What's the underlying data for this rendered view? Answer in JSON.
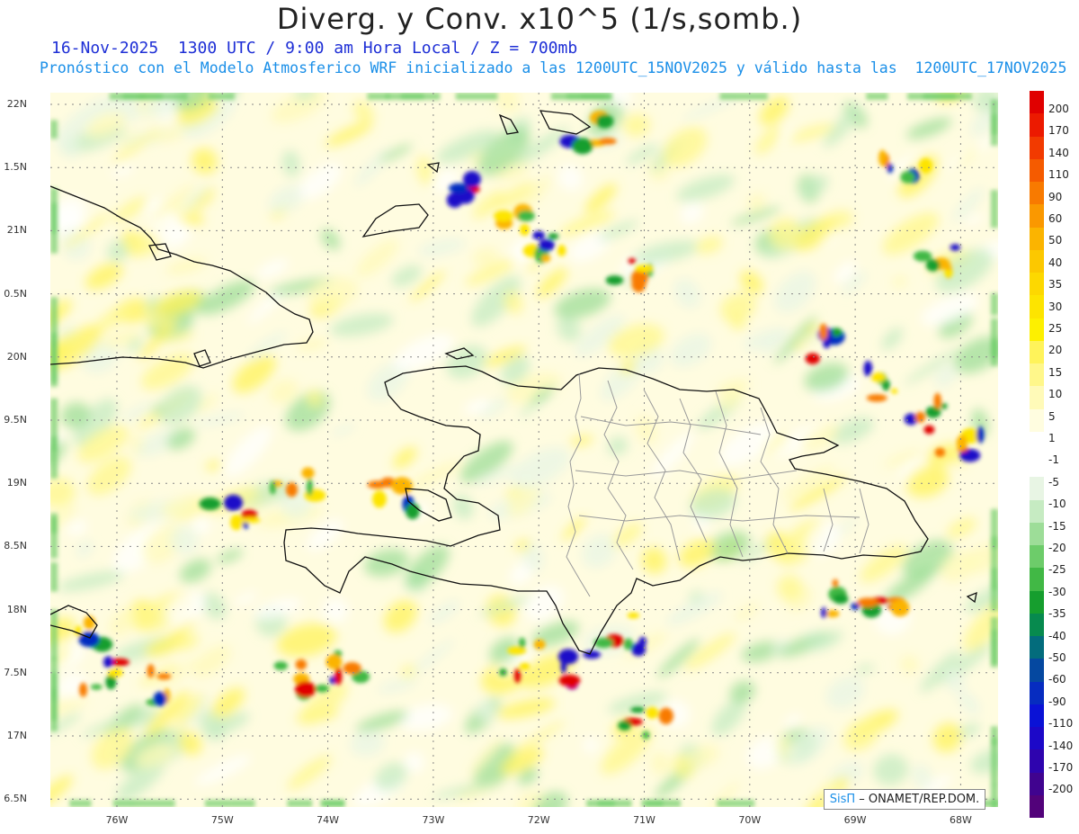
{
  "title": "Diverg. y Conv. x10^5 (1/s,somb.)",
  "subtitle_line1": "16-Nov-2025  1300 UTC / 9:00 am Hora Local / Z = 700mb",
  "subtitle_line2": "Pronóstico con el Modelo Atmosferico WRF inicializado a las 1200UTC_15NOV2025 y válido hasta las  1200UTC_17NOV2025",
  "lat_labels": [
    "22N",
    "1.5N",
    "21N",
    "0.5N",
    "20N",
    "9.5N",
    "19N",
    "8.5N",
    "18N",
    "7.5N",
    "17N",
    "6.5N"
  ],
  "lon_labels": [
    "76W",
    "75W",
    "74W",
    "73W",
    "72W",
    "71W",
    "70W",
    "69W",
    "68W"
  ],
  "colorbar": {
    "labels": [
      "200",
      "170",
      "140",
      "110",
      "90",
      "60",
      "50",
      "40",
      "35",
      "30",
      "25",
      "20",
      "15",
      "10",
      "5",
      "1",
      "-1",
      "-5",
      "-10",
      "-15",
      "-20",
      "-25",
      "-30",
      "-35",
      "-40",
      "-50",
      "-60",
      "-90",
      "-110",
      "-140",
      "-170",
      "-200"
    ],
    "colors": [
      "#e00000",
      "#ec1a00",
      "#f23a00",
      "#f55b00",
      "#f87a00",
      "#fa9800",
      "#fbb400",
      "#fcc800",
      "#fdd800",
      "#fde400",
      "#fdf000",
      "#fff35a",
      "#fff78a",
      "#fffab8",
      "#fffde0",
      "#ffffff",
      "#ffffff",
      "#e8f5e4",
      "#c6ebc2",
      "#9ddd98",
      "#6dcc6a",
      "#41b845",
      "#169e2e",
      "#078a4e",
      "#036c7c",
      "#0548a0",
      "#062cc0",
      "#0a12d6",
      "#1c08c8",
      "#2e04ae",
      "#40038f",
      "#52027a"
    ]
  },
  "credit": {
    "brand": "SisΠ",
    "text": "– ONAMET/REP.DOM."
  }
}
